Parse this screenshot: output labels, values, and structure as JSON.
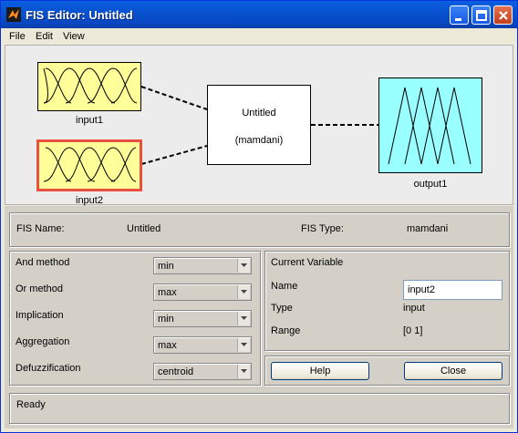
{
  "window": {
    "title": "FIS Editor: Untitled"
  },
  "menu": {
    "file": "File",
    "edit": "Edit",
    "view": "View"
  },
  "diagram": {
    "input1_label": "input1",
    "input2_label": "input2",
    "output1_label": "output1",
    "system_name": "Untitled",
    "system_type": "(mamdani)"
  },
  "fis_info": {
    "name_label": "FIS Name:",
    "name_value": "Untitled",
    "type_label": "FIS Type:",
    "type_value": "mamdani"
  },
  "methods": {
    "and_label": "And method",
    "and_value": "min",
    "or_label": "Or method",
    "or_value": "max",
    "imp_label": "Implication",
    "imp_value": "min",
    "agg_label": "Aggregation",
    "agg_value": "max",
    "defuzz_label": "Defuzzification",
    "defuzz_value": "centroid"
  },
  "current_variable": {
    "title": "Current Variable",
    "name_label": "Name",
    "name_value": "input2",
    "type_label": "Type",
    "type_value": "input",
    "range_label": "Range",
    "range_value": "[0 1]"
  },
  "buttons": {
    "help": "Help",
    "close": "Close"
  },
  "status": {
    "text": "Ready"
  },
  "colors": {
    "input_fill": "#ffff99",
    "output_fill": "#99ffff",
    "selected_border": "#e85040"
  }
}
